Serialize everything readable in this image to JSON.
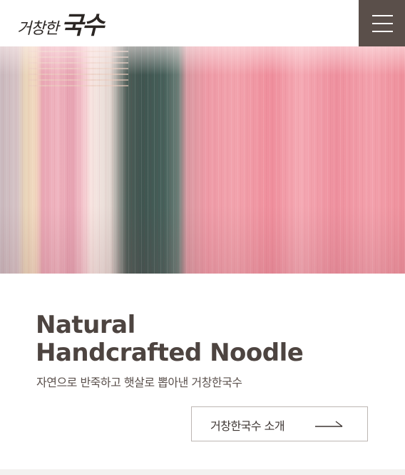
{
  "header": {
    "logo_small": "거창한",
    "logo_big": "국수",
    "menu_icon": "hamburger-menu-icon"
  },
  "hero": {
    "image_desc_icon": "noodle-drying-photo"
  },
  "intro": {
    "title": "Natural\nHandcrafted Noodle",
    "subtitle": "자연으로 반죽하고 햇살로 뽑아낸 거창한국수",
    "cta_label": "거창한국수 소개",
    "cta_icon": "long-arrow-right-icon"
  },
  "colors": {
    "menu_bg": "#5a4f4a",
    "title_text": "#4d4440",
    "cta_border": "#bdb6b3"
  }
}
